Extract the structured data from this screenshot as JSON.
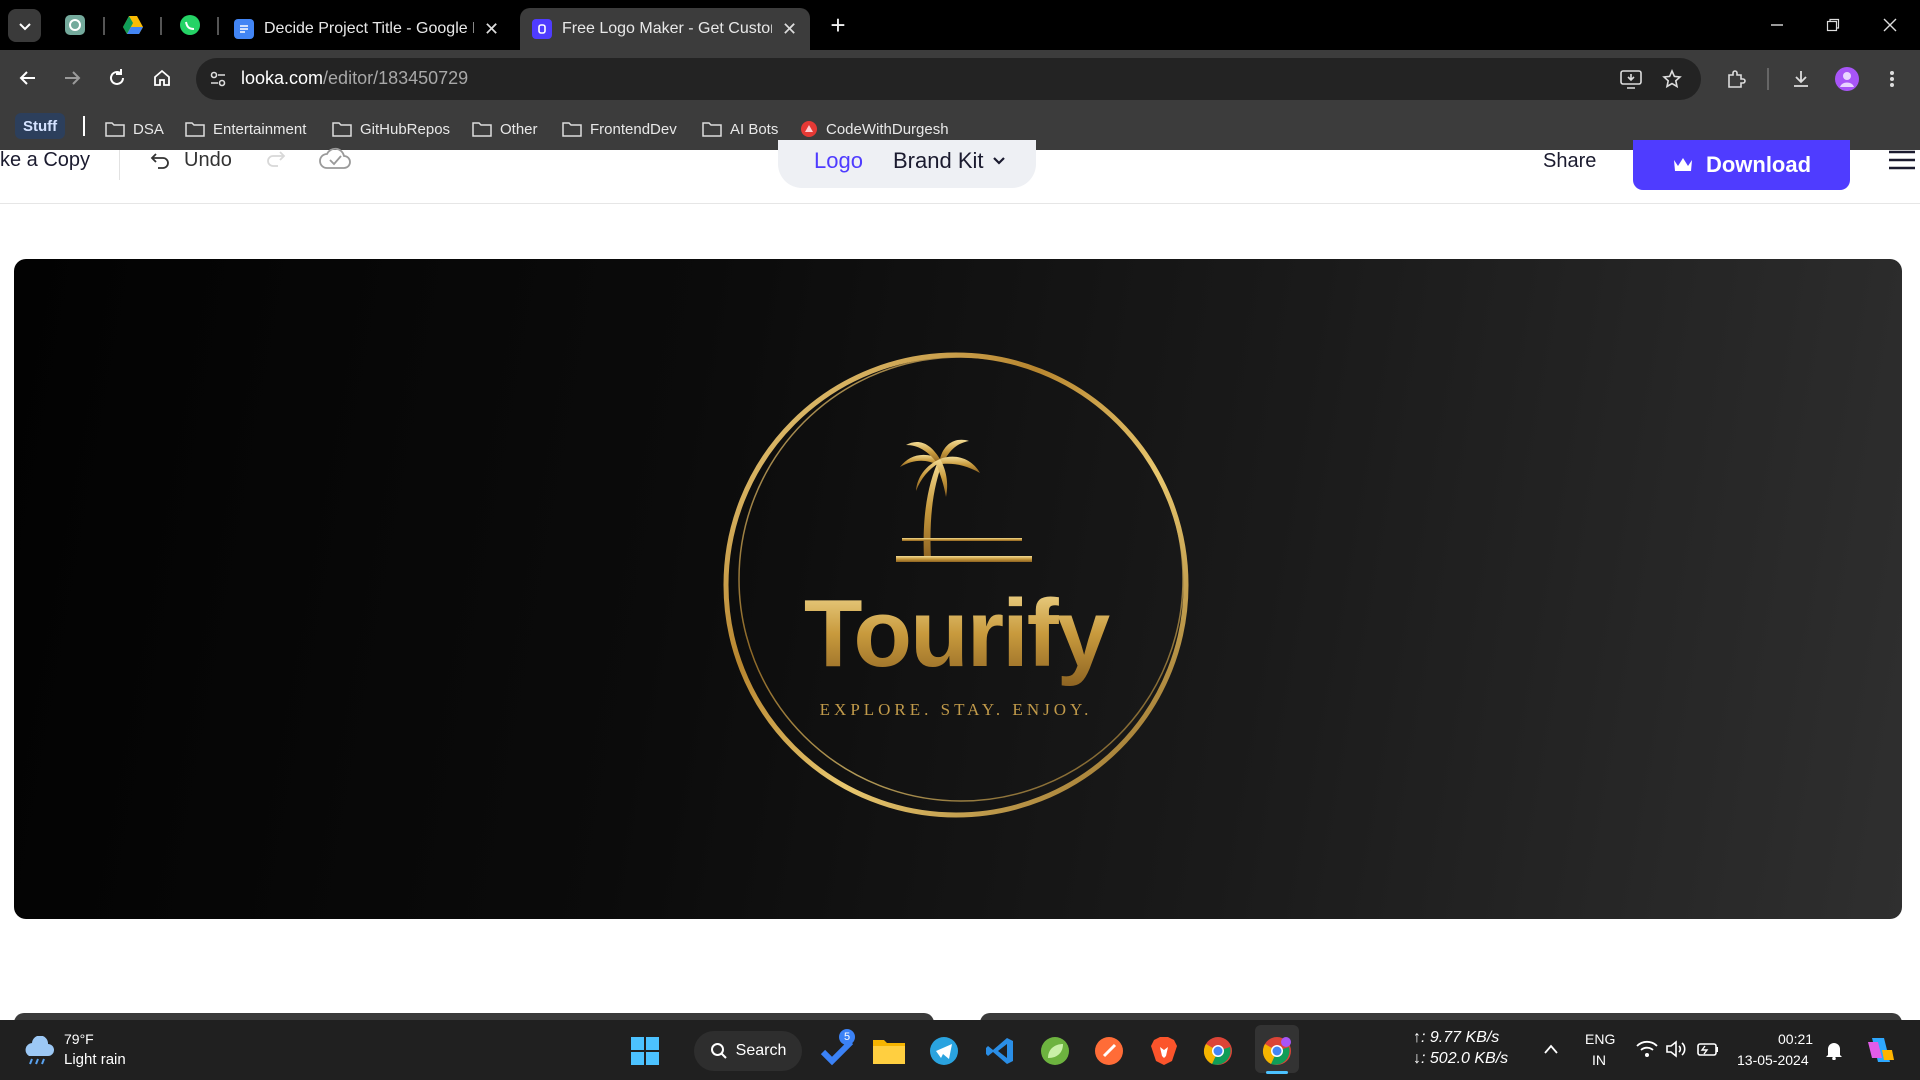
{
  "browser": {
    "tabs": [
      {
        "title": "Decide Project Title - Google Docs",
        "active": false
      },
      {
        "title": "Free Logo Maker - Get Custom Logo Designs",
        "active": true
      }
    ],
    "url_host": "looka.com",
    "url_path": "/editor/183450729",
    "bookmarks": [
      "Stuff",
      "DSA",
      "Entertainment",
      "GitHubRepos",
      "Other",
      "FrontendDev",
      "AI Bots",
      "CodeWithDurgesh"
    ]
  },
  "editor": {
    "make_copy_label": "ke a Copy",
    "undo_label": "Undo",
    "tab_logo": "Logo",
    "tab_brand_kit": "Brand Kit",
    "share_label": "Share",
    "download_label": "Download"
  },
  "logo": {
    "name": "Tourify",
    "tagline": "EXPLORE. STAY. ENJOY."
  },
  "taskbar": {
    "weather_temp": "79°F",
    "weather_desc": "Light rain",
    "search_label": "Search",
    "badge_count": "5",
    "upload_speed": "↑: 9.77 KB/s",
    "download_speed": "↓: 502.0 KB/s",
    "lang_line1": "ENG",
    "lang_line2": "IN",
    "time": "00:21",
    "date": "13-05-2024"
  },
  "colors": {
    "accent": "#4f3cff",
    "gold": "#c9a24a"
  }
}
